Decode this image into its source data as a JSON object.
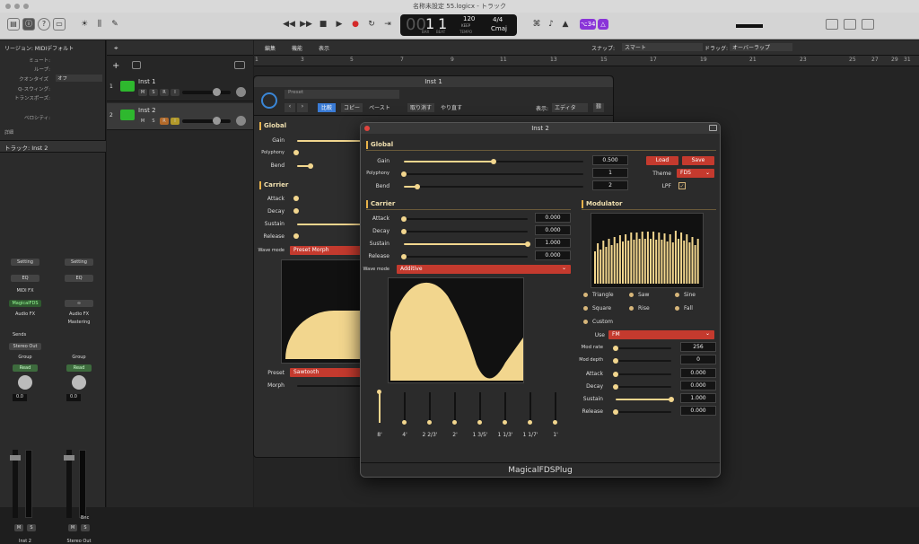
{
  "window": {
    "title": "名称未設定 55.logicx - トラック"
  },
  "transport": {
    "bar": "1",
    "beat": "1",
    "tempo": "120",
    "tempo_mode": "KEEP",
    "tempo_label": "TEMPO",
    "sig": "4/4",
    "key": "Cmaj",
    "bar_label": "BAR",
    "beat_label": "BEAT",
    "count_in": "1234",
    "badge": "⌥34"
  },
  "arrange_bar": {
    "edit": "編集",
    "function": "機能",
    "view": "表示",
    "snap_label": "スナップ:",
    "snap_value": "スマート",
    "drag_label": "ドラッグ:",
    "drag_value": "オーバーラップ"
  },
  "ruler": [
    "1",
    "3",
    "5",
    "7",
    "9",
    "11",
    "13",
    "15",
    "17",
    "19",
    "21",
    "23",
    "25",
    "27",
    "29",
    "31"
  ],
  "inspector": {
    "region": "リージョン: MIDIデフォルト",
    "mute": "ミュート:",
    "loop": "ループ:",
    "quantize": "クオンタイズ",
    "quantize_val": "オフ",
    "q_swing": "Q-スウィング:",
    "transpose": "トランスポーズ:",
    "velocity": "ベロシティ:",
    "details": "詳細",
    "track": "トラック:  Inst 2"
  },
  "tracks": [
    {
      "num": "1",
      "name": "Inst 1"
    },
    {
      "num": "2",
      "name": "Inst 2"
    }
  ],
  "mixer": {
    "setting": "Setting",
    "eq": "EQ",
    "midifx": "MIDI FX",
    "instrument": "MagicalFDS",
    "audiofx": "Audio FX",
    "mastering": "Mastering",
    "sends": "Sends",
    "output": "Stereo Out",
    "group": "Group",
    "read": "Read",
    "vol1": "0.0",
    "vol2": "0.0",
    "bnc": "Bnc",
    "ch1": "Inst 2",
    "ch2": "Stereo Out",
    "m": "M",
    "s": "S"
  },
  "inst1": {
    "title": "Inst 1",
    "preset": "Preset",
    "compare": "比較",
    "copy": "コピー",
    "paste": "ペースト",
    "undo": "取り消す",
    "redo": "やり直す",
    "view_label": "表示:",
    "view_val": "エディタ",
    "global": "Global",
    "gain": "Gain",
    "polyphony": "Polyphony",
    "bend": "Bend",
    "carrier": "Carrier",
    "attack": "Attack",
    "decay": "Decay",
    "sustain": "Sustain",
    "release": "Release",
    "wave_mode": "Wave mode",
    "wave_mode_val": "Preset Morph",
    "preset_val": "Sawtooth",
    "morph": "Morph"
  },
  "inst2": {
    "title": "Inst 2",
    "footer": "MagicalFDSPlug",
    "global": {
      "label": "Global",
      "gain": "Gain",
      "gain_val": "0.500",
      "gain_level": 0.5,
      "polyphony": "Polyphony",
      "polyphony_val": "1",
      "bend": "Bend",
      "bend_val": "2",
      "load": "Load",
      "save": "Save",
      "theme": "Theme",
      "theme_val": "FDS",
      "lpf": "LPF"
    },
    "carrier": {
      "label": "Carrier",
      "attack": "Attack",
      "attack_val": "0.000",
      "decay": "Decay",
      "decay_val": "0.000",
      "sustain": "Sustain",
      "sustain_val": "1.000",
      "release": "Release",
      "release_val": "0.000",
      "wave_mode": "Wave mode",
      "wave_mode_val": "Additive",
      "harmonics": [
        "8'",
        "4'",
        "2 2/3'",
        "2'",
        "1 3/5'",
        "1 1/3'",
        "1 1/7'",
        "1'"
      ],
      "harmonic_levels": [
        1,
        0,
        0,
        0,
        0,
        0,
        0,
        0
      ]
    },
    "modulator": {
      "label": "Modulator",
      "waves": [
        "Triangle",
        "Saw",
        "Sine",
        "Square",
        "Rise",
        "Fall",
        "Custom"
      ],
      "use": "Use",
      "use_val": "FM",
      "mod_rate": "Mod rate",
      "mod_rate_val": "256",
      "mod_depth": "Mod depth",
      "mod_depth_val": "0",
      "attack": "Attack",
      "attack_val": "0.000",
      "decay": "Decay",
      "decay_val": "0.000",
      "sustain": "Sustain",
      "sustain_val": "1.000",
      "release": "Release",
      "release_val": "0.000"
    }
  }
}
